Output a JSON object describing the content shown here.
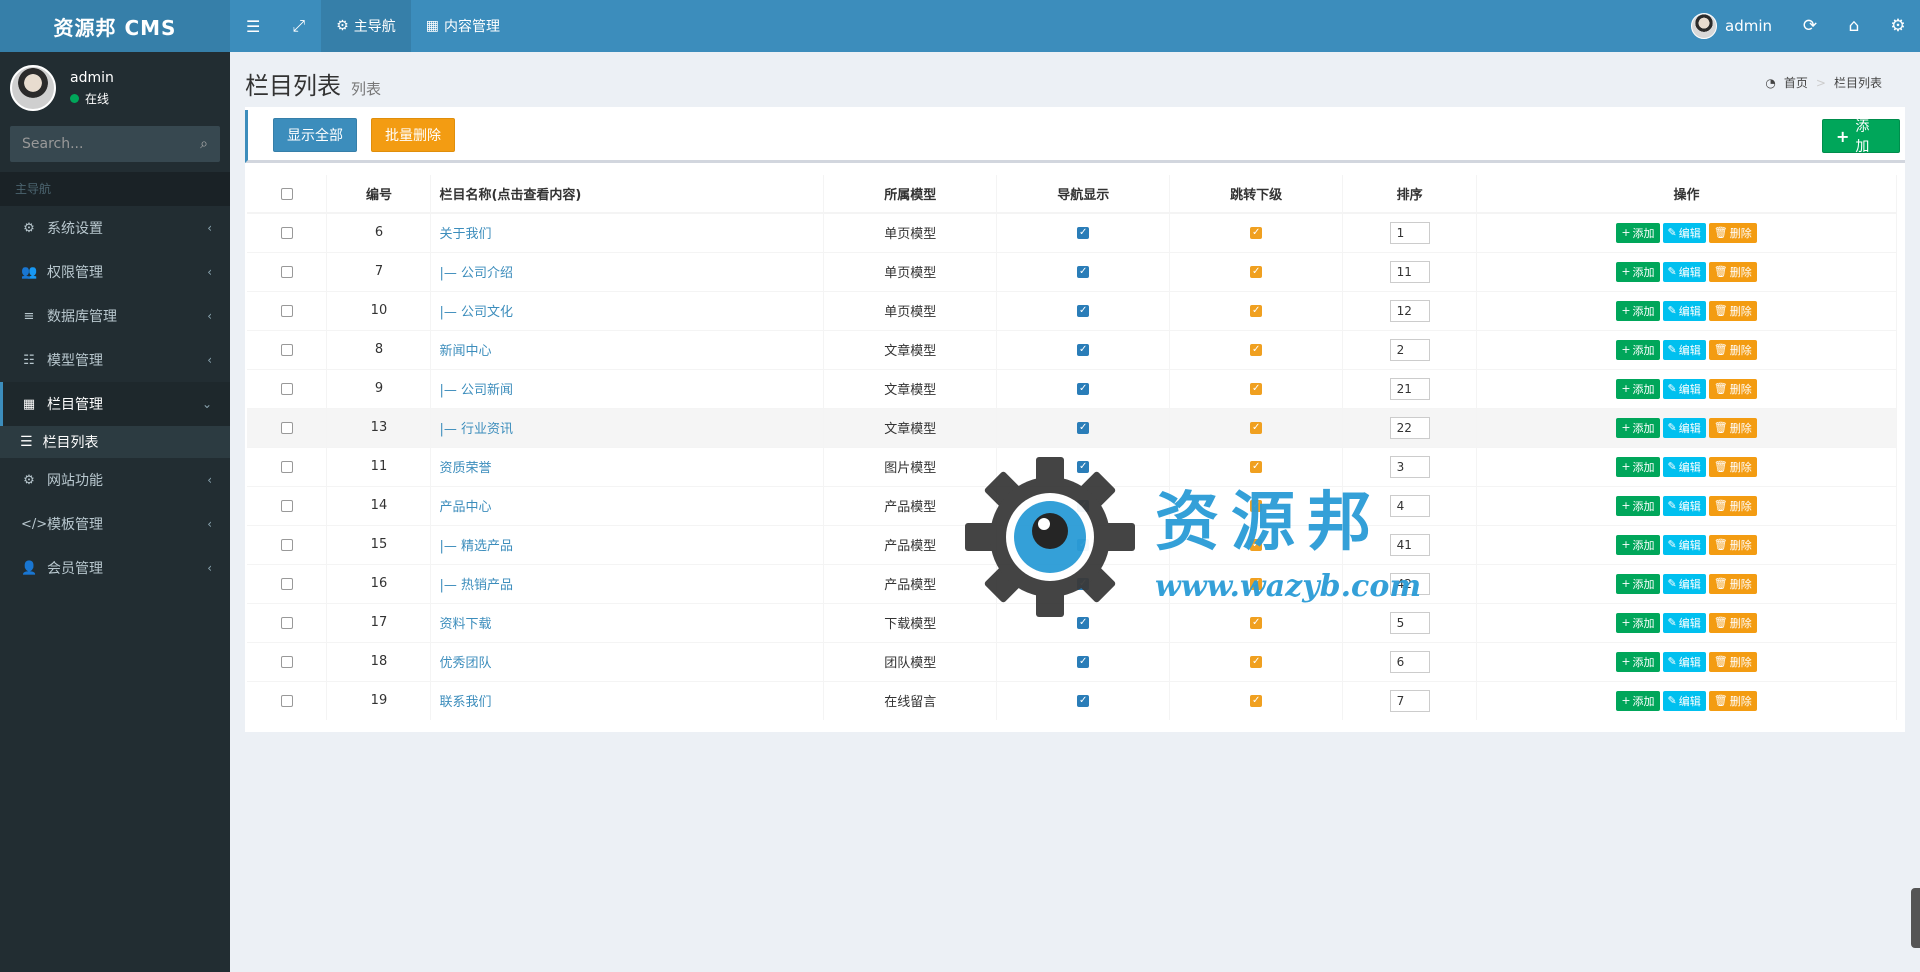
{
  "app": {
    "title": "资源邦 CMS"
  },
  "header": {
    "tabs": [
      {
        "label": "主导航",
        "icon": "gear-icon"
      },
      {
        "label": "内容管理",
        "icon": "grid-icon"
      }
    ],
    "user": "admin"
  },
  "sidebar": {
    "user": {
      "name": "admin",
      "status": "在线"
    },
    "search": {
      "placeholder": "Search..."
    },
    "header": "主导航",
    "items": [
      {
        "label": "系统设置",
        "icon": "gears-icon"
      },
      {
        "label": "权限管理",
        "icon": "users-icon"
      },
      {
        "label": "数据库管理",
        "icon": "database-icon"
      },
      {
        "label": "模型管理",
        "icon": "list-icon"
      },
      {
        "label": "栏目管理",
        "icon": "grid-icon"
      },
      {
        "label": "网站功能",
        "icon": "gear-icon"
      },
      {
        "label": "模板管理",
        "icon": "code-icon"
      },
      {
        "label": "会员管理",
        "icon": "user-icon"
      }
    ],
    "subitem": {
      "label": "栏目列表",
      "icon": "bars-icon"
    }
  },
  "page": {
    "title": "栏目列表",
    "subtitle": "列表",
    "breadcrumb": {
      "home": "首页",
      "current": "栏目列表"
    }
  },
  "toolbar": {
    "show_all": "显示全部",
    "batch_delete": "批量删除",
    "add": "添 加"
  },
  "table": {
    "headers": [
      "编号",
      "栏目名称(点击查看内容)",
      "所属模型",
      "导航显示",
      "跳转下级",
      "排序",
      "操作"
    ],
    "actions": {
      "add": "添加",
      "edit": "编辑",
      "delete": "删除"
    },
    "rows": [
      {
        "id": "6",
        "name": "关于我们",
        "model": "单页模型",
        "sort": "1"
      },
      {
        "id": "7",
        "name": "|— 公司介绍",
        "model": "单页模型",
        "sort": "11"
      },
      {
        "id": "10",
        "name": "|— 公司文化",
        "model": "单页模型",
        "sort": "12"
      },
      {
        "id": "8",
        "name": "新闻中心",
        "model": "文章模型",
        "sort": "2"
      },
      {
        "id": "9",
        "name": "|— 公司新闻",
        "model": "文章模型",
        "sort": "21"
      },
      {
        "id": "13",
        "name": "|— 行业资讯",
        "model": "文章模型",
        "sort": "22"
      },
      {
        "id": "11",
        "name": "资质荣誉",
        "model": "图片模型",
        "sort": "3"
      },
      {
        "id": "14",
        "name": "产品中心",
        "model": "产品模型",
        "sort": "4"
      },
      {
        "id": "15",
        "name": "|— 精选产品",
        "model": "产品模型",
        "sort": "41"
      },
      {
        "id": "16",
        "name": "|— 热销产品",
        "model": "产品模型",
        "sort": "42"
      },
      {
        "id": "17",
        "name": "资料下载",
        "model": "下载模型",
        "sort": "5"
      },
      {
        "id": "18",
        "name": "优秀团队",
        "model": "团队模型",
        "sort": "6"
      },
      {
        "id": "19",
        "name": "联系我们",
        "model": "在线留言",
        "sort": "7"
      }
    ]
  },
  "watermark": {
    "text": "资源邦",
    "url": "www.wazyb.com"
  }
}
